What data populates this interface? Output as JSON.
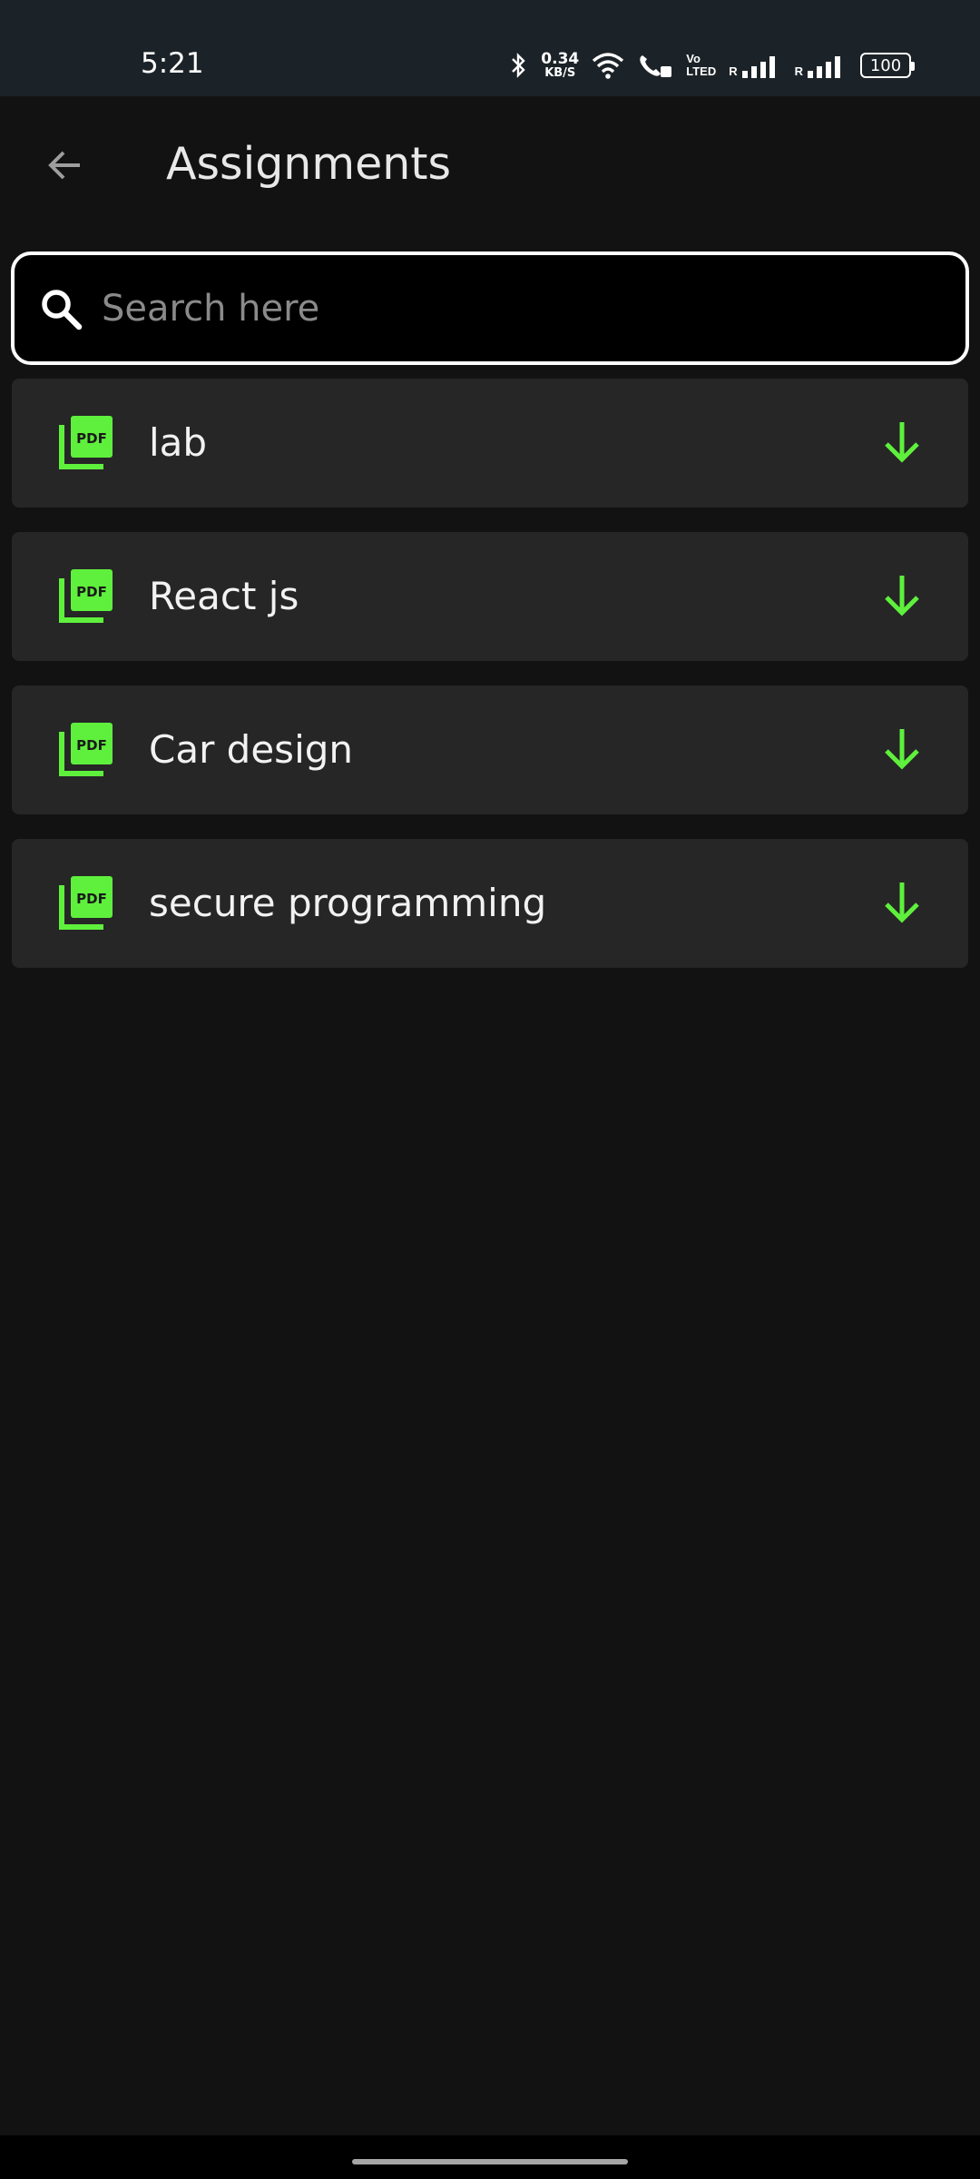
{
  "status_bar": {
    "time": "5:21",
    "net_speed_value": "0.34",
    "net_speed_unit": "KB/S",
    "volte_top": "Vo",
    "volte_bottom": "LTED",
    "roaming_1": "R",
    "roaming_2": "R",
    "battery": "100"
  },
  "header": {
    "title": "Assignments"
  },
  "search": {
    "placeholder": "Search here",
    "value": ""
  },
  "assignments": [
    {
      "label": "lab",
      "icon": "pdf-icon",
      "action": "download-icon"
    },
    {
      "label": "React js",
      "icon": "pdf-icon",
      "action": "download-icon"
    },
    {
      "label": "Car design",
      "icon": "pdf-icon",
      "action": "download-icon"
    },
    {
      "label": "secure programming",
      "icon": "pdf-icon",
      "action": "download-icon"
    }
  ],
  "colors": {
    "accent_green": "#5ef03c",
    "background": "#121212",
    "card": "#262626",
    "status_bar": "#1c2328"
  }
}
